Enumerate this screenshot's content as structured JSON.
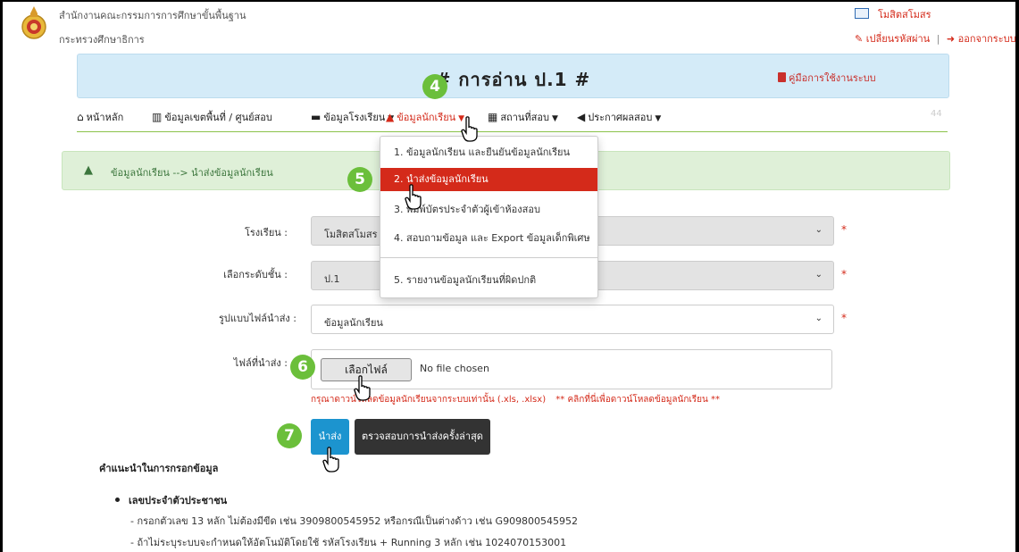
{
  "header": {
    "org_line1": "สำนักงานคณะกรรมการการศึกษาขั้นพื้นฐาน",
    "org_line2": "กระทรวงศึกษาธิการ",
    "user_name": "โมสิตสโมสร",
    "change_password": "เปลี่ยนรหัสผ่าน",
    "logout": "ออกจากระบบ"
  },
  "banner": {
    "title": "# การอ่าน ป.1 #",
    "manual": "คู่มือการใช้งานระบบ"
  },
  "nav": {
    "home": "หน้าหลัก",
    "area": "ข้อมูลเขตพื้นที่ / ศูนย์สอบ",
    "school": "ข้อมูลโรงเรียน",
    "student": "ข้อมูลนักเรียน",
    "venue": "สถานที่สอบ",
    "results": "ประกาศผลสอบ",
    "faint": "44"
  },
  "dropdown": {
    "items": [
      "1. ข้อมูลนักเรียน และยืนยันข้อมูลนักเรียน",
      "2. นำส่งข้อมูลนักเรียน",
      "3. พิมพ์บัตรประจำตัวผู้เข้าห้องสอบ",
      "4. สอบถามข้อมูล และ Export ข้อมูลเด็กพิเศษ",
      "5. รายงานข้อมูลนักเรียนที่ผิดปกติ"
    ]
  },
  "breadcrumb": "ข้อมูลนักเรียน --> นำส่งข้อมูลนักเรียน",
  "form": {
    "school_label": "โรงเรียน :",
    "school_value": "โมสิตสโมสร (1",
    "grade_label": "เลือกระดับชั้น :",
    "grade_value": "ป.1",
    "filetype_label": "รูปแบบไฟล์นำส่ง :",
    "filetype_value": "ข้อมูลนักเรียน",
    "file_label": "ไฟล์ที่นำส่ง :",
    "file_button": "เลือกไฟล์",
    "file_status": "No file chosen",
    "help_text": "กรุณาดาวน์โหลดข้อมูลนักเรียนจากระบบเท่านั้น (.xls, .xlsx)",
    "help_link": "** คลิกที่นี่เพื่อดาวน์โหลดข้อมูลนักเรียน **",
    "submit": "นำส่ง",
    "check_last": "ตรวจสอบการนำส่งครั้งล่าสุด"
  },
  "instructions": {
    "title": "คำแนะนำในการกรอกข้อมูล",
    "bullet": "เลขประจำตัวประชาชน",
    "line1": "- กรอกตัวเลข 13 หลัก ไม่ต้องมีขีด เช่น 3909800545952 หรือกรณีเป็นต่างด้าว เช่น G909800545952",
    "line2": "- ถ้าไม่ระบุระบบจะกำหนดให้อัตโนมัติโดยใช้ รหัสโรงเรียน + Running 3 หลัก เช่น 1024070153001"
  },
  "steps": [
    "4",
    "5",
    "6",
    "7"
  ],
  "colors": {
    "accent_red": "#d42a1a",
    "banner_blue": "#d4ebf8",
    "badge_green": "#6bbf3b",
    "submit_blue": "#1c94cf"
  }
}
